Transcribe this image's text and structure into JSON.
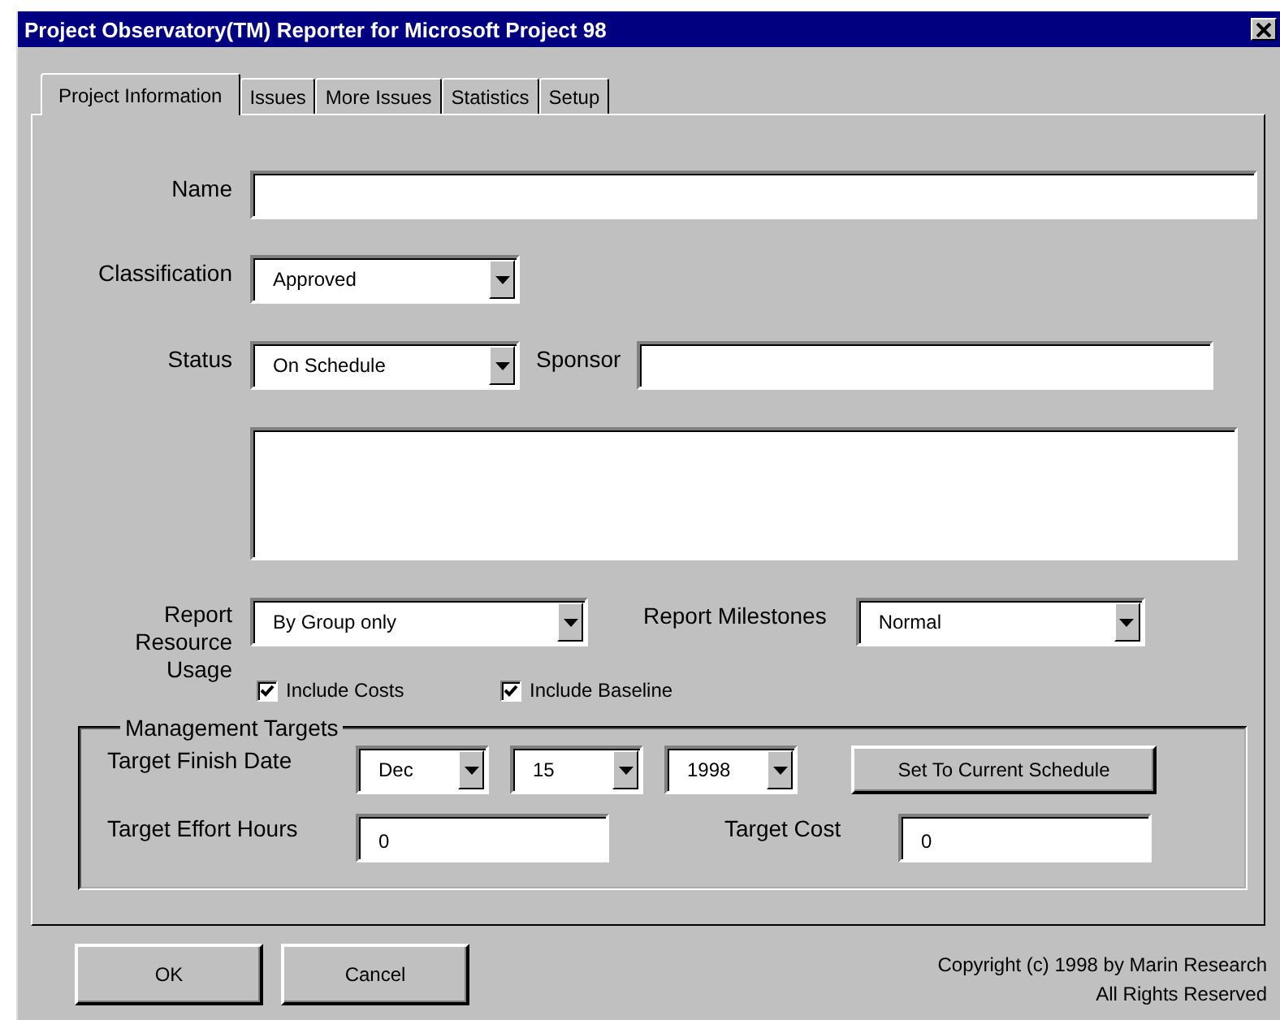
{
  "window": {
    "title": "Project Observatory(TM) Reporter for Microsoft Project 98"
  },
  "tabs": [
    {
      "label": "Project Information",
      "selected": true
    },
    {
      "label": "Issues",
      "selected": false
    },
    {
      "label": "More Issues",
      "selected": false
    },
    {
      "label": "Statistics",
      "selected": false
    },
    {
      "label": "Setup",
      "selected": false
    }
  ],
  "name": {
    "label": "Name"
  },
  "classification": {
    "label": "Classification",
    "value": "Approved"
  },
  "status": {
    "label": "Status",
    "value": "On Schedule"
  },
  "sponsor": {
    "label": "Sponsor"
  },
  "report_resource_usage": {
    "label_lines": [
      "Report",
      "Resource",
      "Usage"
    ],
    "value": "By Group only"
  },
  "report_milestones": {
    "label": "Report Milestones",
    "value": "Normal"
  },
  "checkboxes": [
    {
      "label": "Include Costs",
      "checked": true
    },
    {
      "label": "Include Baseline",
      "checked": true
    }
  ],
  "management_targets": {
    "title": "Management Targets",
    "target_finish_date": {
      "label": "Target Finish Date",
      "month": "Dec",
      "day": "15",
      "year": "1998"
    },
    "set_button": "Set To Current Schedule",
    "target_effort_hours": {
      "label": "Target Effort Hours",
      "value": "0"
    },
    "target_cost": {
      "label": "Target Cost",
      "value": "0"
    }
  },
  "buttons": [
    "OK",
    "Cancel"
  ],
  "copyright": [
    "Copyright (c) 1998 by Marin Research",
    "All Rights Reserved"
  ]
}
